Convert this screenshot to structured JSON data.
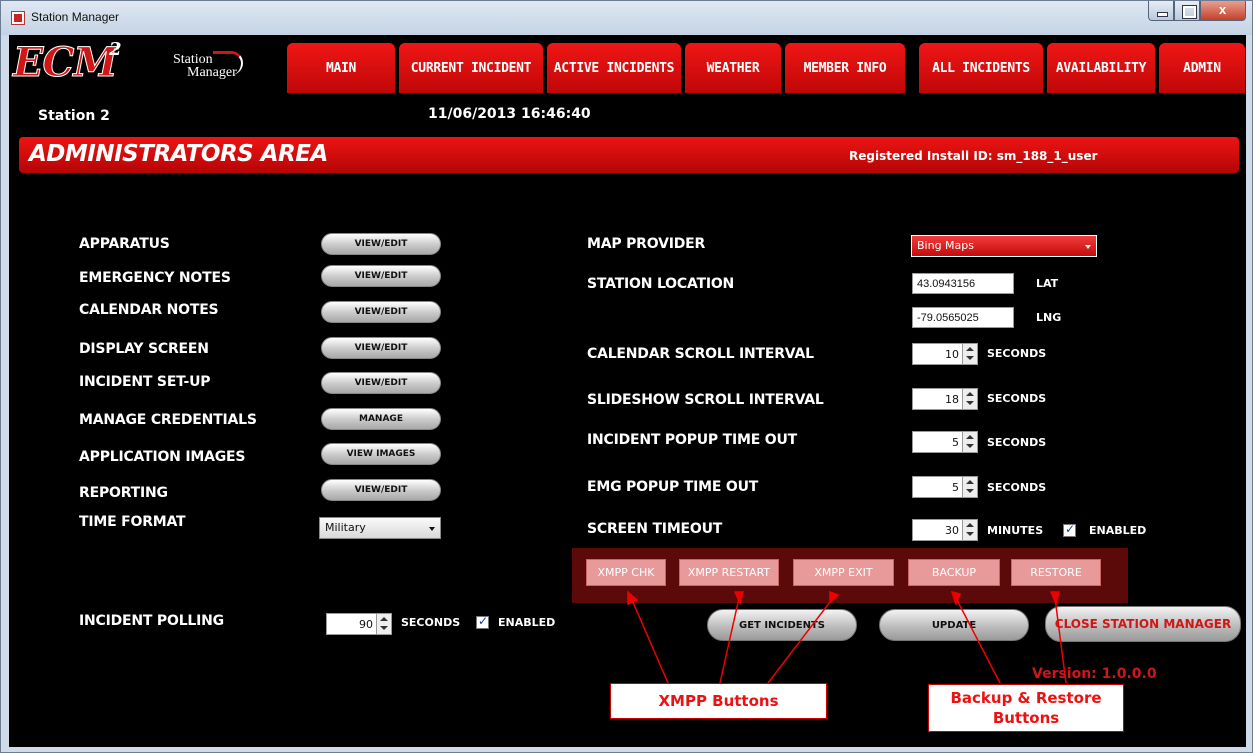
{
  "window": {
    "title": "Station Manager"
  },
  "logo": {
    "brand": "ECM",
    "brand_sup": "2",
    "sub_line1": "Station",
    "sub_line2": "Manager"
  },
  "nav": [
    "MAIN",
    "CURRENT INCIDENT",
    "ACTIVE INCIDENTS",
    "WEATHER",
    "MEMBER INFO",
    "ALL INCIDENTS",
    "AVAILABILITY",
    "ADMIN"
  ],
  "header": {
    "station": "Station 2",
    "datetime": "11/06/2013 16:46:40"
  },
  "admin": {
    "title": "ADMINISTRATORS AREA",
    "install_id": "Registered Install ID: sm_188_1_user"
  },
  "left": {
    "items": [
      {
        "label": "APPARATUS",
        "button": "VIEW/EDIT"
      },
      {
        "label": "EMERGENCY NOTES",
        "button": "VIEW/EDIT"
      },
      {
        "label": "CALENDAR NOTES",
        "button": "VIEW/EDIT"
      },
      {
        "label": "DISPLAY SCREEN",
        "button": "VIEW/EDIT"
      },
      {
        "label": "INCIDENT SET-UP",
        "button": "VIEW/EDIT"
      },
      {
        "label": "MANAGE CREDENTIALS",
        "button": "MANAGE"
      },
      {
        "label": "APPLICATION IMAGES",
        "button": "VIEW IMAGES"
      },
      {
        "label": "REPORTING",
        "button": "VIEW/EDIT"
      }
    ],
    "time_format_label": "TIME FORMAT",
    "time_format_value": "Military",
    "polling_label": "INCIDENT POLLING",
    "polling_value": "90",
    "polling_unit": "SECONDS",
    "polling_enabled": "ENABLED"
  },
  "right": {
    "map_label": "MAP PROVIDER",
    "map_value": "Bing Maps",
    "location_label": "STATION LOCATION",
    "lat_value": "43.0943156",
    "lat_label": "LAT",
    "lng_value": "-79.0565025",
    "lng_label": "LNG",
    "calendar_label": "CALENDAR SCROLL INTERVAL",
    "calendar_value": "10",
    "slideshow_label": "SLIDESHOW SCROLL INTERVAL",
    "slideshow_value": "18",
    "incident_popup_label": "INCIDENT POPUP TIME OUT",
    "incident_popup_value": "5",
    "emg_popup_label": "EMG POPUP TIME OUT",
    "emg_popup_value": "5",
    "screen_timeout_label": "SCREEN TIMEOUT",
    "screen_timeout_value": "30",
    "seconds": "SECONDS",
    "minutes": "MINUTES",
    "enabled": "ENABLED"
  },
  "xmpp": [
    "XMPP CHK",
    "XMPP RESTART",
    "XMPP EXIT",
    "BACKUP",
    "RESTORE"
  ],
  "actions": {
    "get_incidents": "GET INCIDENTS",
    "update": "UPDATE",
    "close": "CLOSE STATION MANAGER"
  },
  "version": "Version: 1.0.0.0",
  "callouts": {
    "xmpp": "XMPP Buttons",
    "backup_line1": "Backup & Restore",
    "backup_line2": "Buttons"
  },
  "colors": {
    "brand_red": "#d01616",
    "panel_dark_red": "#5c0909",
    "xmpp_button": "#e89a9a"
  }
}
